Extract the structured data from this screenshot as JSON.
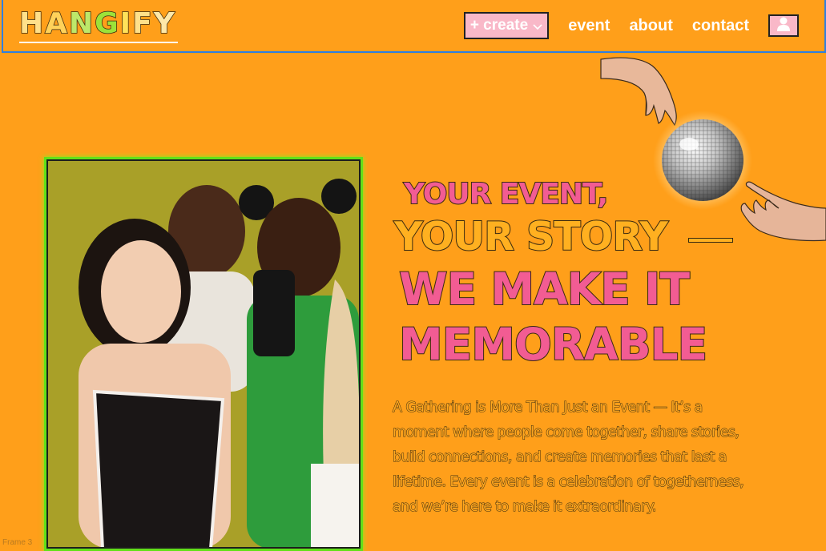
{
  "header": {
    "logo": [
      "H",
      "A",
      "N",
      "G",
      "I",
      "F",
      "Y"
    ],
    "logo_colors": [
      "#ffe08a",
      "#ffd25a",
      "#bde86a",
      "#9be23a",
      "#ffe25a",
      "#ffe08a",
      "#ffe8a8"
    ],
    "create_label": "+ create",
    "nav": {
      "event": "event",
      "about": "about",
      "contact": "contact"
    }
  },
  "hero": {
    "line1": "YOUR EVENT,",
    "line2": "YOUR STORY",
    "line3": "WE MAKE IT",
    "line4": "MEMORABLE",
    "paragraph": "A Gathering is More Than Just an Event — It’s a moment where people come together, share stories, build connections, and create memories that last a lifetime. Every event is a celebration of togetherness, and we’re here to make it extraordinary."
  },
  "frame_label": "Frame 3",
  "colors": {
    "background": "#ff9f1a",
    "pink": "#f25c93",
    "yellow": "#ffb020",
    "button_pink": "#f9b8c8",
    "photo_border": "#62e019",
    "photo_bg": "#a9a028"
  },
  "icons": {
    "profile": "user-icon",
    "dropdown": "chevron-down-icon",
    "disco": "disco-ball",
    "hands": "hand-illustration"
  }
}
